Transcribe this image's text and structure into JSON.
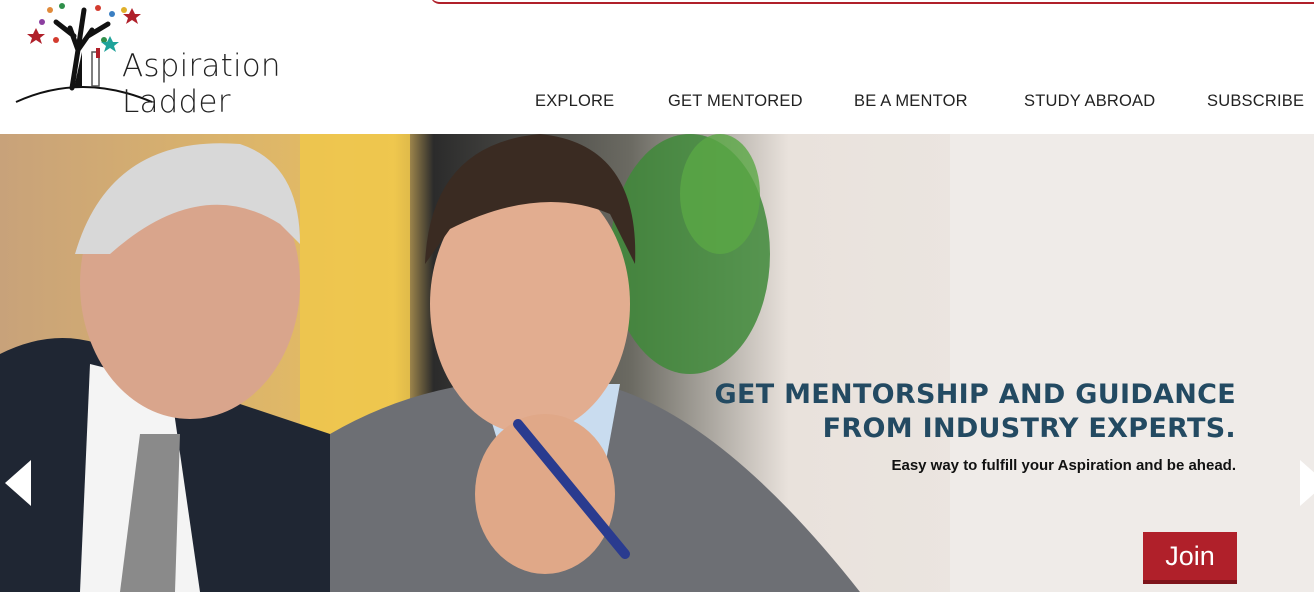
{
  "brand": {
    "name": "Aspiration Ladder"
  },
  "nav": {
    "items": [
      "EXPLORE",
      "GET MENTORED",
      "BE A MENTOR",
      "STUDY ABROAD",
      "SUBSCRIBE"
    ]
  },
  "hero": {
    "headline_line1": "GET MENTORSHIP AND GUIDANCE",
    "headline_line2": "FROM INDUSTRY EXPERTS.",
    "subline": "Easy way to fulfill your Aspiration and be ahead.",
    "cta_label": "Join"
  },
  "colors": {
    "accent": "#b0202a",
    "headline": "#234a62",
    "nav_text": "#222222"
  }
}
